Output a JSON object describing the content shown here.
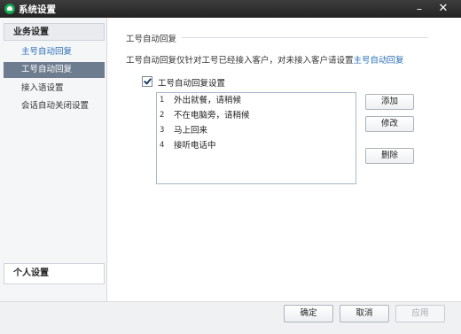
{
  "window": {
    "title": "系统设置",
    "minimize_glyph": "–",
    "close_glyph": "✕"
  },
  "sidebar": {
    "group_business": "业务设置",
    "items": [
      {
        "label": "主号自动回复"
      },
      {
        "label": "工号自动回复"
      },
      {
        "label": "接入语设置"
      },
      {
        "label": "会话自动关闭设置"
      }
    ],
    "group_personal": "个人设置"
  },
  "content": {
    "section_title": "工号自动回复",
    "description_prefix": "工号自动回复仅针对工号已经接入客户，对未接入客户请设置",
    "description_link": "主号自动回复",
    "checkbox_label": "工号自动回复设置",
    "checkbox_checked": true,
    "replies": [
      {
        "num": "1",
        "text": "外出就餐，请稍候"
      },
      {
        "num": "2",
        "text": "不在电脑旁，请稍候"
      },
      {
        "num": "3",
        "text": "马上回来"
      },
      {
        "num": "4",
        "text": "接听电话中"
      }
    ],
    "buttons": {
      "add": "添加",
      "edit": "修改",
      "delete": "删除"
    }
  },
  "footer": {
    "ok": "确定",
    "cancel": "取消",
    "apply": "应用"
  },
  "colors": {
    "titlebar": "#2b2b2b",
    "selected_item": "#6d7c8f",
    "link": "#2a6fb8",
    "app_icon": "#1fb15a"
  },
  "icons": {
    "app": "app-logo-icon",
    "check": "checkmark-icon"
  }
}
